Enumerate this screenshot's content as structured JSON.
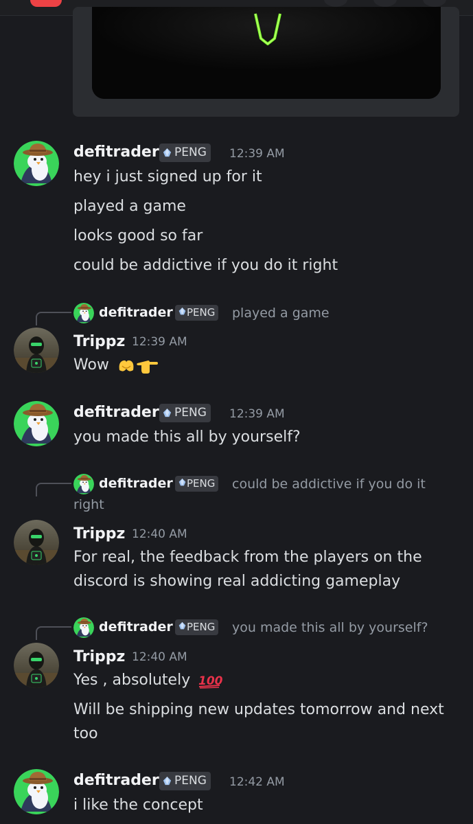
{
  "colors": {
    "background": "#1a1b1f",
    "username": "#f2f3f5",
    "message_text": "#dbdee1",
    "timestamp": "#949ba4",
    "tag_bg": "#383a40",
    "avatar_penguin_bg": "#3ad45a"
  },
  "users": {
    "defitrader": "defitrader",
    "trippz": "Trippz",
    "server_tag": "PENG"
  },
  "messages": [
    {
      "author": "defitrader",
      "time": "12:39 AM",
      "lines": [
        "hey i just signed up for it",
        "played a game",
        "looks good so far",
        "could be addictive if you do it right"
      ]
    },
    {
      "reply_to": {
        "author": "defitrader",
        "tag": "PENG",
        "text": "played a game"
      },
      "author": "Trippz",
      "time": "12:39 AM",
      "lines": [
        "Wow"
      ],
      "emoji": [
        "heart-hands-emoji",
        "pointing-hand-emoji"
      ]
    },
    {
      "author": "defitrader",
      "time": "12:39 AM",
      "lines": [
        "you made this all by yourself?"
      ]
    },
    {
      "reply_to": {
        "author": "defitrader",
        "tag": "PENG",
        "text": "could be addictive if you do it",
        "text_cont": "right"
      },
      "author": "Trippz",
      "time": "12:40 AM",
      "lines": [
        "For real, the feedback from the players on the",
        "discord is showing real addicting gameplay"
      ]
    },
    {
      "reply_to": {
        "author": "defitrader",
        "tag": "PENG",
        "text": "you made this all by yourself?"
      },
      "author": "Trippz",
      "time": "12:40 AM",
      "lines": [
        "Yes , absolutely",
        "Will be shipping new updates tomorrow and next",
        "too"
      ],
      "emoji": [
        "hundred-points-emoji"
      ]
    },
    {
      "author": "defitrader",
      "time": "12:42 AM",
      "lines": [
        "i like the concept"
      ]
    }
  ]
}
